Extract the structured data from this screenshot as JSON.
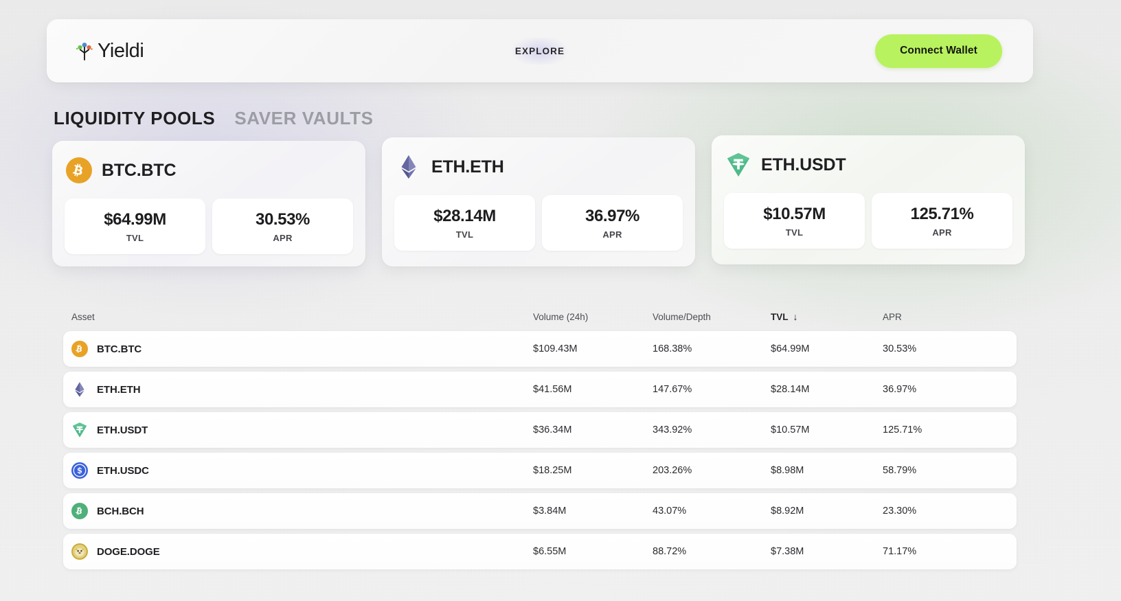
{
  "header": {
    "brand_name": "Yieldi",
    "brand_icon": "sprout-logo-icon",
    "nav_explore": "EXPLORE",
    "connect_wallet": "Connect Wallet",
    "accent_green": "#b8f25f"
  },
  "tabs": [
    {
      "label": "LIQUIDITY POOLS",
      "active": true
    },
    {
      "label": "SAVER VAULTS",
      "active": false
    }
  ],
  "pool_cards": [
    {
      "title": "BTC.BTC",
      "icon": "bitcoin-icon",
      "icon_color": "#e8a225",
      "tvl_value": "$64.99M",
      "tvl_label": "TVL",
      "apr_value": "30.53%",
      "apr_label": "APR"
    },
    {
      "title": "ETH.ETH",
      "icon": "ethereum-icon",
      "icon_color": "#6b6ba8",
      "tvl_value": "$28.14M",
      "tvl_label": "TVL",
      "apr_value": "36.97%",
      "apr_label": "APR"
    },
    {
      "title": "ETH.USDT",
      "icon": "tether-icon",
      "icon_color": "#4cb283",
      "tvl_value": "$10.57M",
      "tvl_label": "TVL",
      "apr_value": "125.71%",
      "apr_label": "APR"
    }
  ],
  "table": {
    "columns": {
      "asset": "Asset",
      "volume_24h": "Volume (24h)",
      "volume_depth": "Volume/Depth",
      "tvl": "TVL",
      "apr": "APR"
    },
    "sort": {
      "column": "TVL",
      "direction": "desc",
      "arrow_glyph": "↓"
    },
    "rows": [
      {
        "asset": "BTC.BTC",
        "icon": "bitcoin-icon",
        "volume_24h": "$109.43M",
        "volume_depth": "168.38%",
        "tvl": "$64.99M",
        "apr": "30.53%"
      },
      {
        "asset": "ETH.ETH",
        "icon": "ethereum-icon",
        "volume_24h": "$41.56M",
        "volume_depth": "147.67%",
        "tvl": "$28.14M",
        "apr": "36.97%"
      },
      {
        "asset": "ETH.USDT",
        "icon": "tether-icon",
        "volume_24h": "$36.34M",
        "volume_depth": "343.92%",
        "tvl": "$10.57M",
        "apr": "125.71%"
      },
      {
        "asset": "ETH.USDC",
        "icon": "usdc-icon",
        "volume_24h": "$18.25M",
        "volume_depth": "203.26%",
        "tvl": "$8.98M",
        "apr": "58.79%"
      },
      {
        "asset": "BCH.BCH",
        "icon": "bitcoin-cash-icon",
        "volume_24h": "$3.84M",
        "volume_depth": "43.07%",
        "tvl": "$8.92M",
        "apr": "23.30%"
      },
      {
        "asset": "DOGE.DOGE",
        "icon": "dogecoin-icon",
        "volume_24h": "$6.55M",
        "volume_depth": "88.72%",
        "tvl": "$7.38M",
        "apr": "71.17%"
      }
    ]
  }
}
